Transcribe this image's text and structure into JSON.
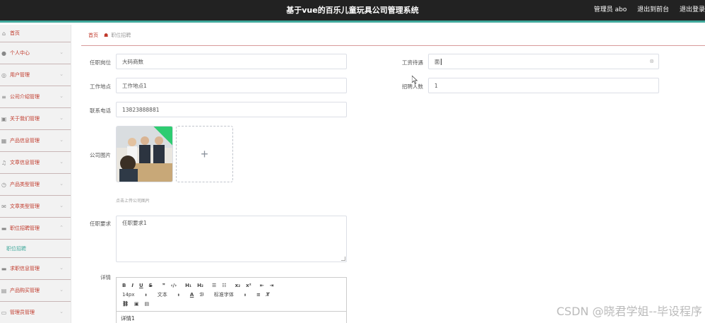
{
  "header": {
    "title": "基于vue的百乐儿童玩具公司管理系统",
    "user": "管理员 abo",
    "exit_front": "退出到前台",
    "logout": "退出登录"
  },
  "sidebar": {
    "items": [
      {
        "label": "首页",
        "icon": "home-icon"
      },
      {
        "label": "个人中心",
        "icon": "user-icon"
      },
      {
        "label": "用户管理",
        "icon": "users-icon"
      },
      {
        "label": "公司介绍管理",
        "icon": "list-icon"
      },
      {
        "label": "关于我们管理",
        "icon": "info-icon"
      },
      {
        "label": "产品信息管理",
        "icon": "grid-icon"
      },
      {
        "label": "文章信息管理",
        "icon": "bell-icon"
      },
      {
        "label": "产品类型管理",
        "icon": "clock-icon"
      },
      {
        "label": "文章类型管理",
        "icon": "mail-icon"
      },
      {
        "label": "职位招聘管理",
        "icon": "monitor-icon"
      }
    ],
    "sub_item": "职位招聘",
    "items_after": [
      {
        "label": "求职信息管理",
        "icon": "monitor-icon"
      },
      {
        "label": "产品购买管理",
        "icon": "cart-icon"
      },
      {
        "label": "管理员管理",
        "icon": "admin-icon"
      }
    ]
  },
  "breadcrumb": {
    "home": "首页",
    "current": "职位招聘"
  },
  "form": {
    "position_label": "任职岗位",
    "position_value": "大码商数",
    "salary_label": "工资待遇",
    "salary_value": "面",
    "location_label": "工作地点",
    "location_value": "工作地点1",
    "headcount_label": "招聘人数",
    "headcount_value": "1",
    "phone_label": "联系电话",
    "phone_value": "13823888881",
    "image_label": "公司图片",
    "upload_hint": "点击上传公司图片",
    "requirement_label": "任职要求",
    "requirement_value": "任职要求1",
    "detail_label": "详情",
    "detail_value": "详情1"
  },
  "editor": {
    "font_size": "14px",
    "paragraph": "文本",
    "font_family": "标准字体"
  },
  "watermark": "CSDN @晓君学姐--毕设程序"
}
